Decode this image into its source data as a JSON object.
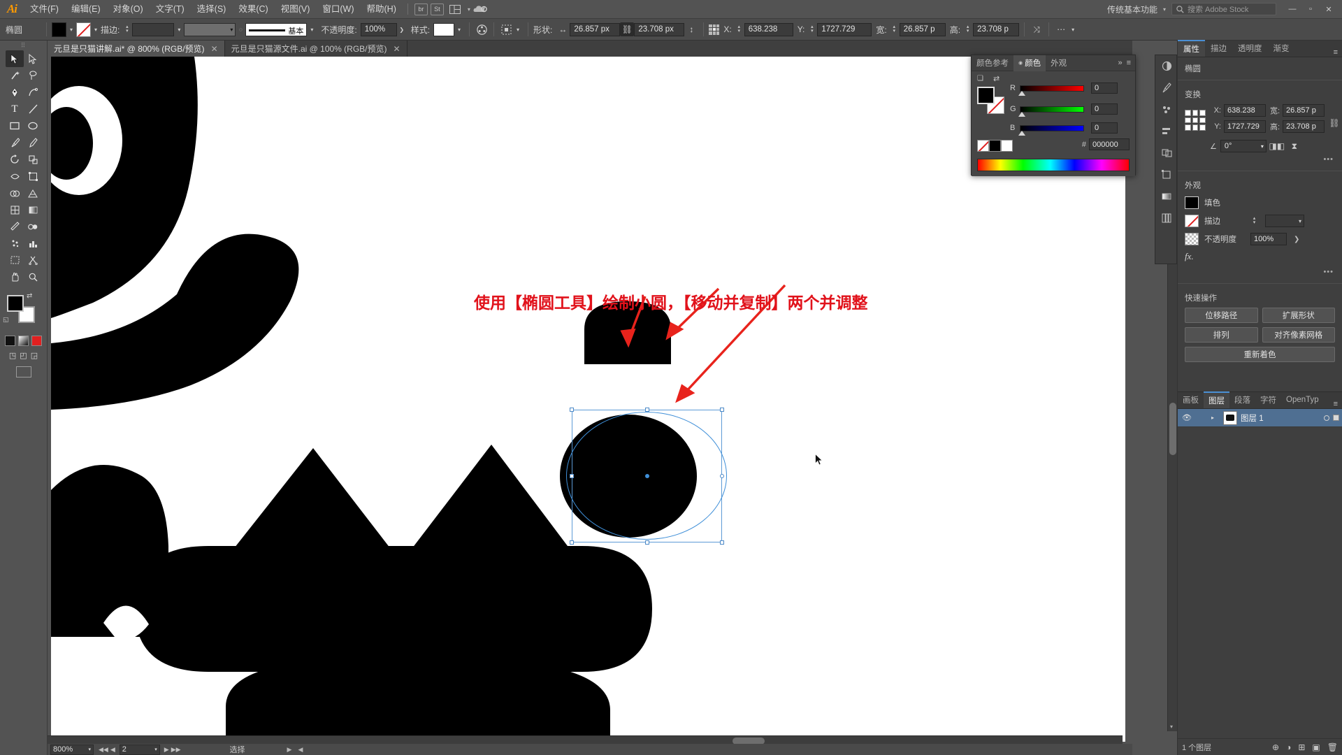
{
  "app": {
    "name": "Adobe Illustrator",
    "logo": "Ai"
  },
  "menubar": {
    "items": [
      {
        "label": "文件(F)"
      },
      {
        "label": "编辑(E)"
      },
      {
        "label": "对象(O)"
      },
      {
        "label": "文字(T)"
      },
      {
        "label": "选择(S)"
      },
      {
        "label": "效果(C)"
      },
      {
        "label": "视图(V)"
      },
      {
        "label": "窗口(W)"
      },
      {
        "label": "帮助(H)"
      }
    ],
    "bridge_icon": "br",
    "stock_icon": "St",
    "arrange_icon": "arrange-documents-icon",
    "cc_icon": "creative-cloud-icon",
    "workspace": "传统基本功能",
    "search_placeholder": "搜索 Adobe Stock",
    "window_buttons": [
      "—",
      "▫",
      "✕"
    ]
  },
  "controlbar": {
    "object_type": "椭圆",
    "fill_label": "fill-swatch",
    "stroke_label": "stroke-swatch",
    "stroke_text": "描边:",
    "stroke_weight": "",
    "profile_text": "基本",
    "opacity_label": "不透明度:",
    "opacity_value": "100%",
    "style_label": "样式:",
    "shape_label": "形状:",
    "width_value": "26.857 px",
    "height_value": "23.708 px",
    "x_label": "X:",
    "x_value": "638.238",
    "y_label": "Y:",
    "y_value": "1727.729",
    "w_label": "宽:",
    "w_value": "26.857 p",
    "h_label": "高:",
    "h_value": "23.708 p"
  },
  "tabs": [
    {
      "title": "元旦是只猫讲解.ai* @ 800% (RGB/预览)",
      "close": "✕",
      "active": true
    },
    {
      "title": "元旦是只猫源文件.ai @ 100% (RGB/预览)",
      "close": "✕",
      "active": false
    }
  ],
  "toolbar": {
    "tools": [
      {
        "name": "selection-tool",
        "glyph": "➤"
      },
      {
        "name": "direct-selection-tool",
        "glyph": "➢"
      },
      {
        "name": "magic-wand-tool",
        "glyph": "✦"
      },
      {
        "name": "lasso-tool",
        "glyph": "◌"
      },
      {
        "name": "pen-tool",
        "glyph": "✒"
      },
      {
        "name": "curvature-tool",
        "glyph": "◜"
      },
      {
        "name": "type-tool",
        "glyph": "T"
      },
      {
        "name": "line-segment-tool",
        "glyph": "╱"
      },
      {
        "name": "rectangle-tool",
        "glyph": "▭"
      },
      {
        "name": "ellipse-tool",
        "glyph": "◯"
      },
      {
        "name": "paintbrush-tool",
        "glyph": "🖌"
      },
      {
        "name": "shaper-tool",
        "glyph": "✎"
      },
      {
        "name": "rotate-tool",
        "glyph": "↻"
      },
      {
        "name": "scale-tool",
        "glyph": "⤢"
      },
      {
        "name": "width-tool",
        "glyph": "⌁"
      },
      {
        "name": "free-transform-tool",
        "glyph": "⧉"
      },
      {
        "name": "shape-builder-tool",
        "glyph": "⬡"
      },
      {
        "name": "perspective-grid-tool",
        "glyph": "▦"
      },
      {
        "name": "mesh-tool",
        "glyph": "⊞"
      },
      {
        "name": "gradient-tool",
        "glyph": "▤"
      },
      {
        "name": "eyedropper-tool",
        "glyph": "⟡"
      },
      {
        "name": "blend-tool",
        "glyph": "◑"
      },
      {
        "name": "symbol-sprayer-tool",
        "glyph": "⁂"
      },
      {
        "name": "column-graph-tool",
        "glyph": "▥"
      },
      {
        "name": "artboard-tool",
        "glyph": "⬓"
      },
      {
        "name": "slice-tool",
        "glyph": "✂"
      },
      {
        "name": "hand-tool",
        "glyph": "✋"
      },
      {
        "name": "zoom-tool",
        "glyph": "🔍"
      }
    ],
    "fill_color": "#000000",
    "stroke_color": "#ffffff",
    "default_colors_icon": "default-fill-stroke-icon",
    "swap_icon": "swap-fill-stroke-icon",
    "color_modes": [
      "color-mode",
      "gradient-mode",
      "none-mode"
    ],
    "screen_mode_icon": "screen-mode-icon"
  },
  "canvas": {
    "annotation_text": "使用【椭圆工具】绘制小圆，【移动并复制】两个并调整",
    "annotation_color": "#e1121b",
    "arrow_color": "#e8231c",
    "artwork_fill": "#000000",
    "selection_color": "#3f8fd8"
  },
  "colorpanel": {
    "tabs": [
      {
        "label": "颜色参考",
        "active": false
      },
      {
        "label": "颜色",
        "active": true
      },
      {
        "label": "外观",
        "active": false
      }
    ],
    "collapse_icon": "»",
    "menu_icon": "≡",
    "channels": [
      {
        "name": "R",
        "value": "0",
        "from": "#000000",
        "to": "#ff0000"
      },
      {
        "name": "G",
        "value": "0",
        "from": "#000000",
        "to": "#00ff00"
      },
      {
        "name": "B",
        "value": "0",
        "from": "#000000",
        "to": "#0000ff"
      }
    ],
    "hex_label": "#",
    "hex_value": "000000",
    "fill_color": "#000000"
  },
  "dockrail": {
    "icons": [
      {
        "name": "color-rail-icon",
        "glyph": "◧"
      },
      {
        "name": "brushes-rail-icon",
        "glyph": "✑"
      },
      {
        "name": "symbols-rail-icon",
        "glyph": "✱"
      },
      {
        "name": "align-rail-icon",
        "glyph": "⊟"
      },
      {
        "name": "pathfinder-rail-icon",
        "glyph": "◫"
      },
      {
        "name": "transform-rail-icon",
        "glyph": "⊡"
      },
      {
        "name": "gradient-rail-icon",
        "glyph": "◐"
      },
      {
        "name": "libraries-rail-icon",
        "glyph": "▤"
      }
    ]
  },
  "properties": {
    "tabs": [
      {
        "label": "属性",
        "active": true
      },
      {
        "label": "描边",
        "active": false
      },
      {
        "label": "透明度",
        "active": false
      },
      {
        "label": "渐变",
        "active": false
      }
    ],
    "object_name": "椭圆",
    "transform": {
      "title": "变换",
      "x_label": "X:",
      "x_value": "638.238",
      "y_label": "Y:",
      "y_value": "1727.729",
      "w_label": "宽:",
      "w_value": "26.857 p",
      "h_label": "高:",
      "h_value": "23.708 p",
      "angle_label": "angle-icon",
      "angle_value": "0°",
      "link_icon": "link-wh-icon",
      "flip_h_icon": "flip-horizontal-icon",
      "flip_v_icon": "flip-vertical-icon",
      "more_icon": "•••"
    },
    "appearance": {
      "title": "外观",
      "fill_label": "填色",
      "fill_color": "#000000",
      "stroke_label": "描边",
      "stroke_value": "",
      "opacity_label": "不透明度",
      "opacity_value": "100%",
      "fx_label": "fx.",
      "more_icon": "•••"
    },
    "quick_actions": {
      "title": "快速操作",
      "buttons": [
        {
          "label": "位移路径"
        },
        {
          "label": "扩展形状"
        },
        {
          "label": "排列"
        },
        {
          "label": "对齐像素网格"
        },
        {
          "label": "重新着色",
          "full": true
        }
      ]
    }
  },
  "layers": {
    "tabs": [
      {
        "label": "画板",
        "active": false
      },
      {
        "label": "图层",
        "active": true
      },
      {
        "label": "段落",
        "active": false
      },
      {
        "label": "字符",
        "active": false
      },
      {
        "label": "OpenTyp",
        "active": false
      }
    ],
    "menu_icon": "≡",
    "rows": [
      {
        "name": "图层 1",
        "visible": true,
        "eye_icon": "👁",
        "expand_icon": "▸",
        "thumb": "layer-thumbnail"
      }
    ],
    "footer": {
      "count_text": "1 个图层",
      "icons": [
        {
          "name": "locate-object-icon",
          "glyph": "⊕"
        },
        {
          "name": "make-clipping-mask-icon",
          "glyph": "◑"
        },
        {
          "name": "create-sublayer-icon",
          "glyph": "⊞"
        },
        {
          "name": "create-layer-icon",
          "glyph": "▣"
        },
        {
          "name": "delete-layer-icon",
          "glyph": "🗑"
        }
      ]
    }
  },
  "statusbar": {
    "zoom_value": "800%",
    "first_icon": "◀◀",
    "prev_icon": "◀",
    "page_value": "2",
    "next_icon": "▶",
    "last_icon": "▶▶",
    "tool_status": "选择",
    "nav_left": "◀",
    "nav_right": "▶"
  }
}
